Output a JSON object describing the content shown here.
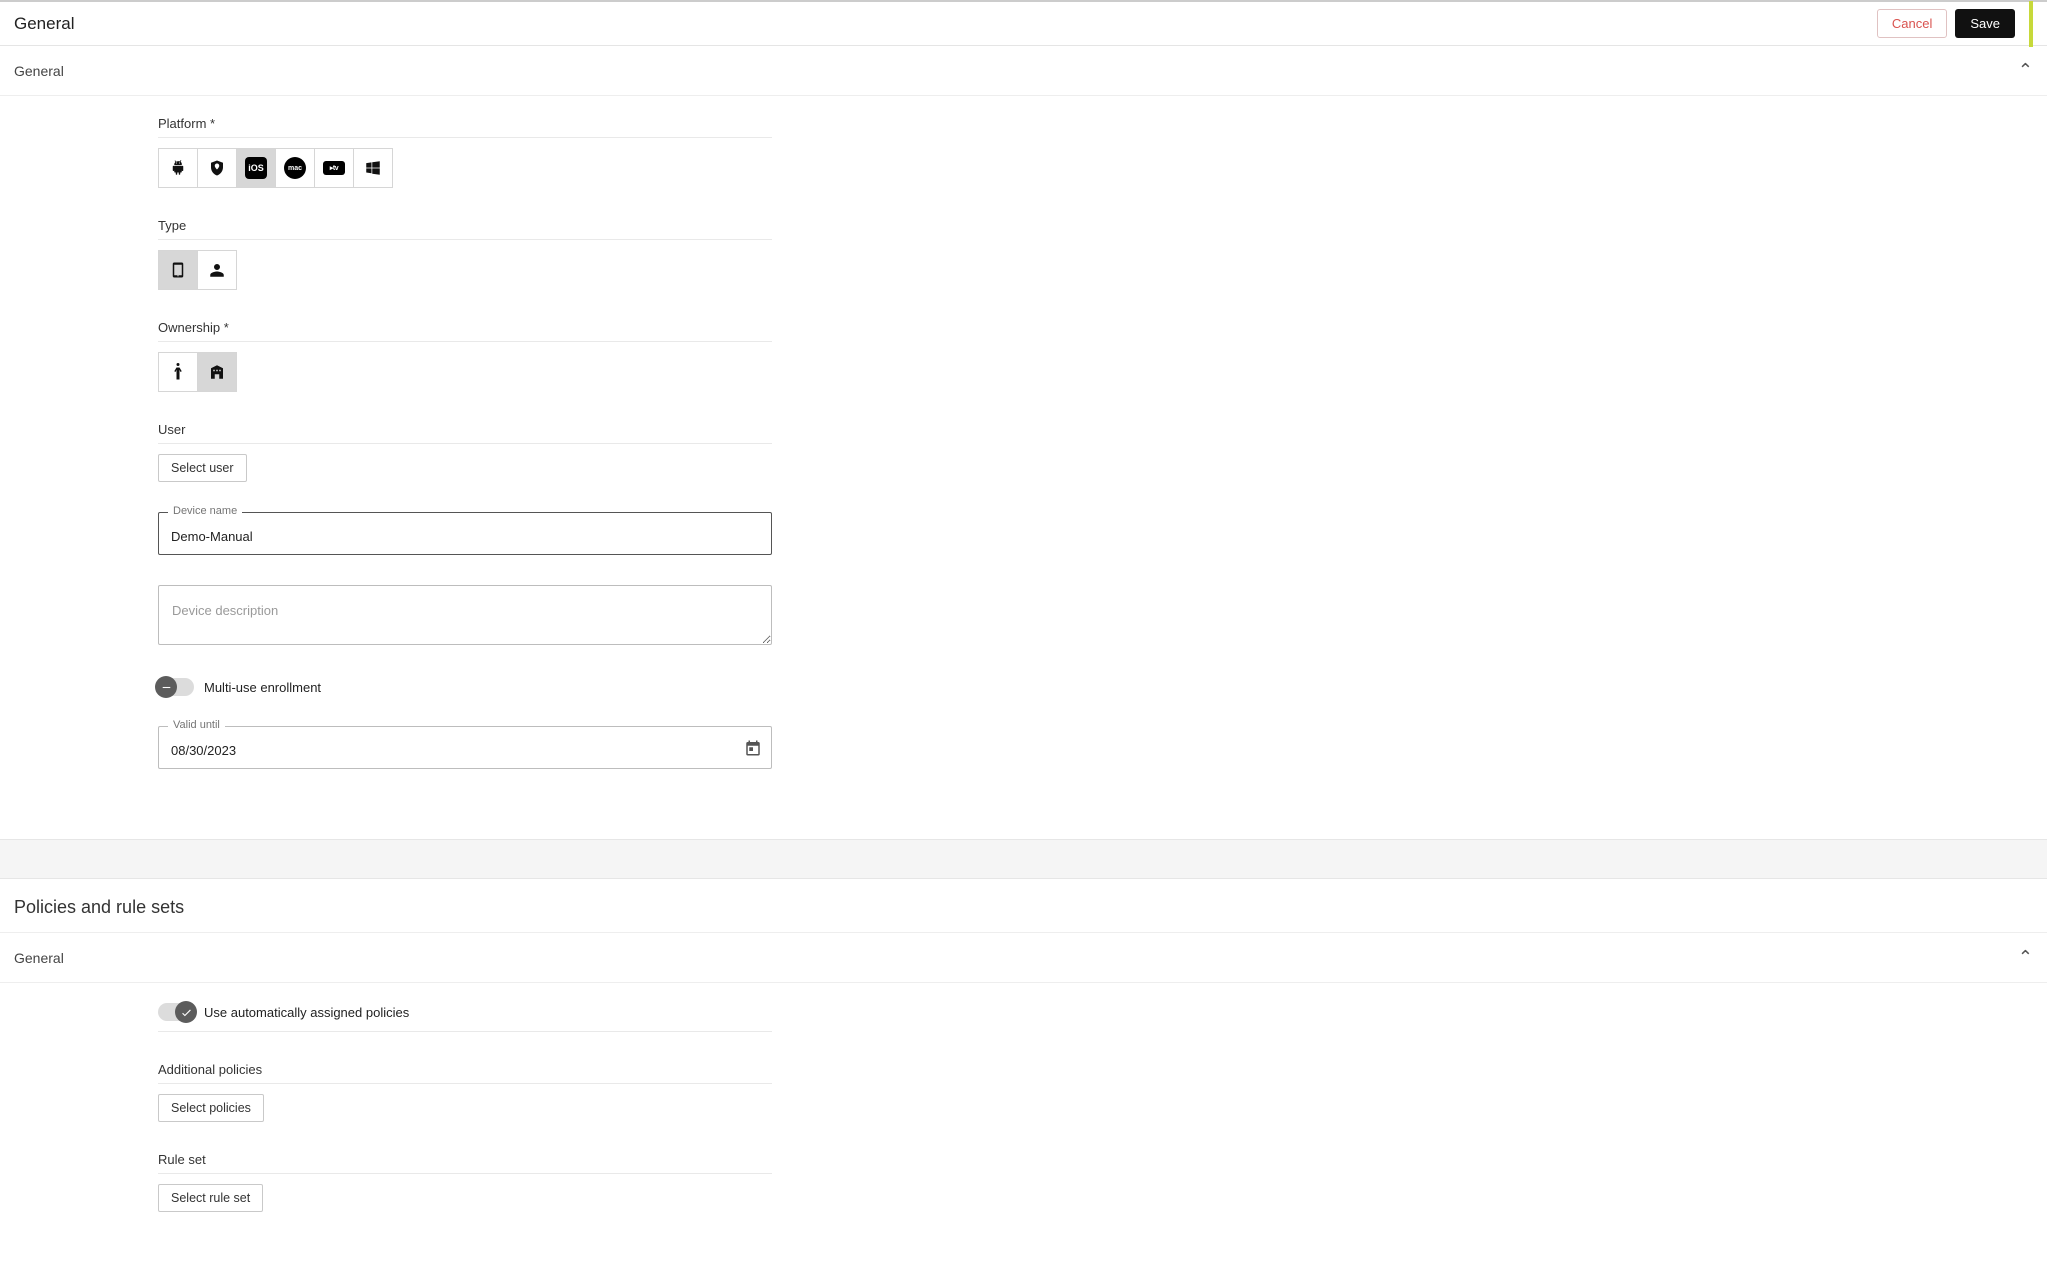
{
  "header": {
    "title": "General",
    "cancel": "Cancel",
    "save": "Save"
  },
  "section_general": {
    "title": "General",
    "platform": {
      "label": "Platform *",
      "selected_index": 2
    },
    "type": {
      "label": "Type",
      "selected_index": 0
    },
    "ownership": {
      "label": "Ownership *",
      "selected_index": 1
    },
    "user": {
      "label": "User",
      "select_button": "Select user"
    },
    "device_name": {
      "label": "Device name",
      "value": "Demo-Manual"
    },
    "device_description": {
      "placeholder": "Device description",
      "value": ""
    },
    "multi_use": {
      "label": "Multi-use enrollment",
      "enabled": false
    },
    "valid_until": {
      "label": "Valid until",
      "value": "08/30/2023"
    }
  },
  "section_policies": {
    "title": "Policies and rule sets",
    "general_label": "General",
    "auto_policies": {
      "label": "Use automatically assigned policies",
      "enabled": true
    },
    "additional_policies": {
      "label": "Additional policies",
      "button": "Select policies"
    },
    "rule_set": {
      "label": "Rule set",
      "button": "Select rule set"
    }
  },
  "icons": {
    "ios": "iOS",
    "mac": "mac",
    "atv": "▸tv"
  }
}
